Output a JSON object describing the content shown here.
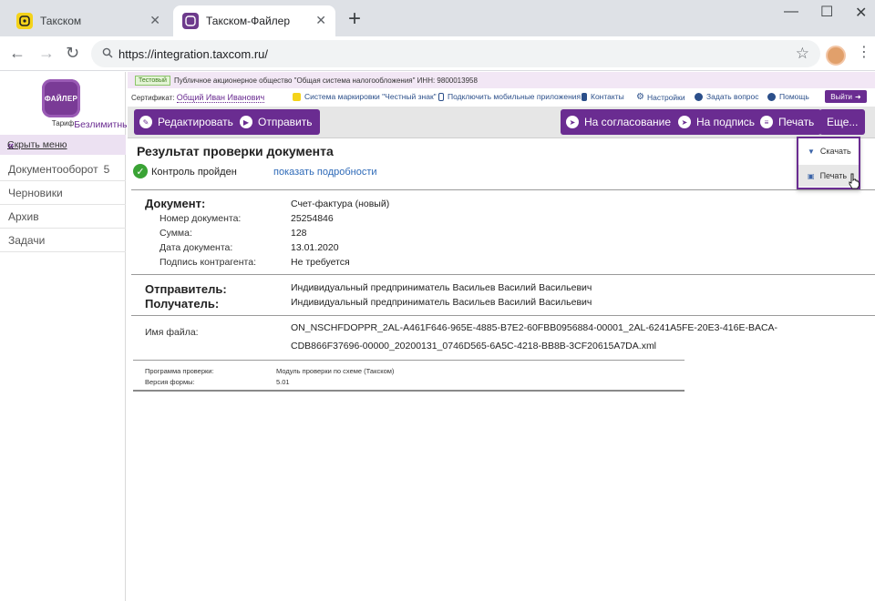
{
  "browser": {
    "tabs": [
      {
        "title": "Такском",
        "favicon": "taxcom-yellow-icon"
      },
      {
        "title": "Такском-Файлер",
        "favicon": "filer-purple-icon"
      }
    ],
    "url": "https://integration.taxcom.ru/"
  },
  "header": {
    "test_badge": "Тестовый",
    "org": "Публичное акционерное общество \"Общая система налогообложения\" ИНН: 9800013958",
    "cert_label": "Сертификат:",
    "cert_name": "Общий Иван Иванович",
    "links": [
      {
        "label": "Система маркировки \"Честный знак\"",
        "icon": "honest-sign-icon"
      },
      {
        "label": "Подключить мобильные приложения",
        "icon": "mobile-icon"
      },
      {
        "label": "Контакты",
        "icon": "contacts-icon"
      },
      {
        "label": "Настройки",
        "icon": "gear-icon"
      },
      {
        "label": "Задать вопрос",
        "icon": "question-icon"
      },
      {
        "label": "Помощь",
        "icon": "info-icon"
      }
    ],
    "exit_label": "Выйти"
  },
  "sidebar": {
    "logo_text": "ФАЙЛЕР",
    "tariff_label": "Тариф",
    "tariff_value": "Безлимитный",
    "hide_menu": "Скрыть меню",
    "items": [
      {
        "label": "Документооборот",
        "count": "5"
      },
      {
        "label": "Черновики",
        "count": ""
      },
      {
        "label": "Архив",
        "count": ""
      },
      {
        "label": "Задачи",
        "count": ""
      }
    ]
  },
  "toolbar": {
    "edit": "Редактировать",
    "send": "Отправить",
    "approve": "На согласование",
    "sign": "На подпись",
    "print": "Печать",
    "more": "Еще..."
  },
  "dropdown": {
    "download": "Скачать",
    "print": "Печать"
  },
  "main": {
    "title": "Результат проверки документа",
    "status": "Контроль пройден",
    "details_link": "показать подробности",
    "document": {
      "heading": "Документ",
      "type": "Счет-фактура (новый)",
      "fields": [
        {
          "label": "Номер документа:",
          "value": "25254846"
        },
        {
          "label": "Сумма:",
          "value": "128"
        },
        {
          "label": "Дата документа:",
          "value": "13.01.2020"
        },
        {
          "label": "Подпись контрагента:",
          "value": "Не требуется"
        }
      ]
    },
    "sender_label": "Отправитель:",
    "sender_value": "Индивидуальный предприниматель Васильев Василий Васильевич",
    "receiver_label": "Получатель:",
    "receiver_value": "Индивидуальный предприниматель Васильев Василий Васильевич",
    "file_label": "Имя файла:",
    "file_line1": "ON_NSCHFDOPPR_2AL-A461F646-965E-4885-B7E2-60FBB0956884-00001_2AL-6241A5FE-20E3-416E-BACA-",
    "file_line2": "CDB866F37696-00000_20200131_0746D565-6A5C-4218-BB8B-3CF20615A7DA.xml",
    "program_label": "Программа проверки:",
    "program_value": "Модуль проверки по схеме (Такском)",
    "form_label": "Версия формы:",
    "form_value": "5.01"
  },
  "colors": {
    "brand": "#6a2c91",
    "toolbar_bg": "#e6e6e6",
    "success": "#3aa335",
    "link": "#2e6ab8"
  }
}
